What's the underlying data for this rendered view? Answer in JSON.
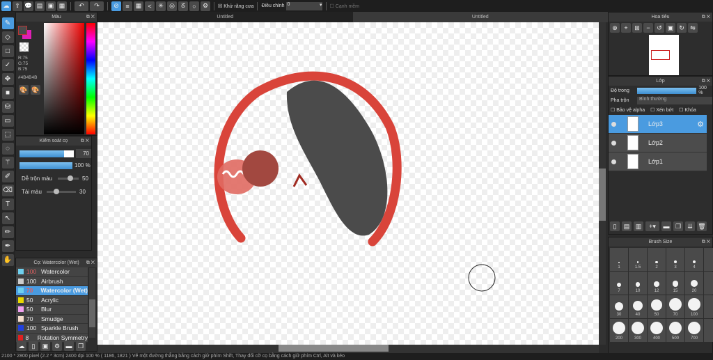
{
  "toolbar": {
    "antialias_label": "Khử răng cưa",
    "adjust_label": "Điều chỉnh",
    "adjust_value": "0",
    "smooth_label": "Cạnh mềm"
  },
  "tabs": [
    "Untitled",
    "Untitled"
  ],
  "color_panel": {
    "title": "Màu",
    "r": "R:75",
    "g": "G:75",
    "b": "B:75",
    "hex": "#4B4B4B",
    "primary": "#4b4b4b",
    "secondary": "#e01fb5"
  },
  "brush_control": {
    "title": "Kiểm soát cọ",
    "size": "70",
    "opacity": "100 %",
    "mix_label": "Dễ trộn màu",
    "mix_value": "50",
    "load_label": "Tải màu",
    "load_value": "30"
  },
  "brush_list": {
    "title": "Cọ: Watercolor (Wet)",
    "items": [
      {
        "size": "100",
        "name": "Watercolor",
        "color": "#6fd0ee"
      },
      {
        "size": "100",
        "name": "Airbrush",
        "color": "#cccccc"
      },
      {
        "size": "70",
        "name": "Watercolor (Wet)",
        "color": "#6fd0ee"
      },
      {
        "size": "50",
        "name": "Acrylic",
        "color": "#e8d800"
      },
      {
        "size": "50",
        "name": "Blur",
        "color": "#f0a0f0"
      },
      {
        "size": "70",
        "name": "Smudge",
        "color": "#f5dccb"
      },
      {
        "size": "100",
        "name": "Sparkle Brush",
        "color": "#2040e0"
      },
      {
        "size": "8",
        "name": "Rotation Symmetry",
        "color": "#e02020"
      }
    ]
  },
  "navigator": {
    "title": "Hoa tiêu"
  },
  "layers": {
    "title": "Lớp",
    "opacity_label": "Độ trong",
    "opacity_value": "100 %",
    "blend_label": "Pha trộn",
    "blend_value": "Bình thường",
    "protect_alpha": "Bảo vệ alpha",
    "clipping": "Xén bớt",
    "lock": "Khóa",
    "items": [
      "Lớp3",
      "Lớp2",
      "Lớp1"
    ]
  },
  "brush_size": {
    "title": "Brush Size",
    "sizes": [
      "1",
      "1.5",
      "2",
      "3",
      "4",
      "7",
      "10",
      "12",
      "15",
      "20",
      "30",
      "40",
      "50",
      "70",
      "100",
      "200",
      "300",
      "400",
      "500",
      "700"
    ]
  },
  "status": "2100 * 2800 pixel   (2.2 * 3cm)   2400 dpi   100 %   ( 1186, 1821 )   Vẽ một đường thẳng bằng cách giữ phím Shift, Thay đổi cỡ cọ bằng cách giữ phím Ctrl, Alt và kéo"
}
